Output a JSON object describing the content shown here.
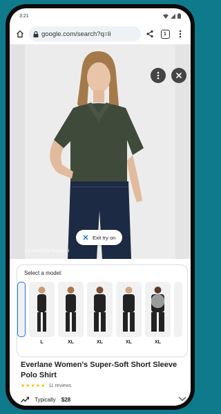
{
  "status_bar": {
    "time": "3:21"
  },
  "browser": {
    "url": "google.com/search?q=li",
    "tab_count": "1"
  },
  "hero": {
    "credit": "Generated by Google AI",
    "exit_label": "Exit try on"
  },
  "picker": {
    "label": "Select a model:",
    "sizes": [
      "",
      "L",
      "XL",
      "XL",
      "XL",
      "XL",
      ""
    ]
  },
  "product": {
    "title": "Everlane Women's Super-Soft Short Sleeve Polo Shirt",
    "stars": "★★★★★",
    "reviews": "11 reviews",
    "price_prefix": "Typically",
    "price": "$28"
  },
  "colors": {
    "shirt": "#3f4a3a",
    "jeans": "#1d2a44",
    "accent": "#1a73e8"
  }
}
